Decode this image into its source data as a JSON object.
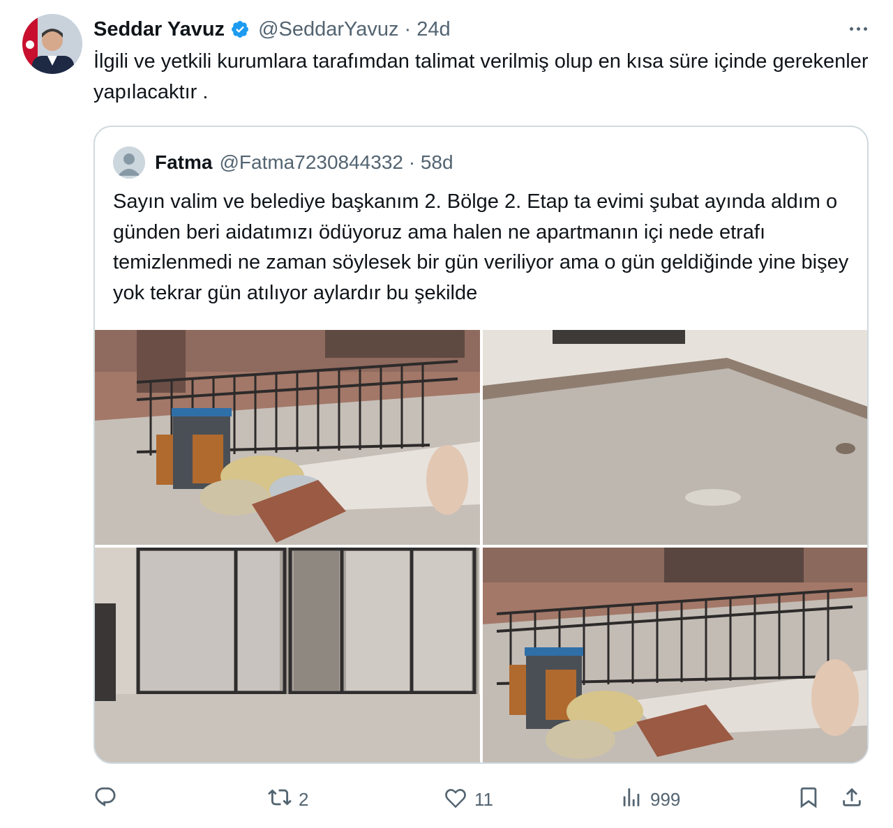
{
  "tweet": {
    "author_name": "Seddar Yavuz",
    "author_handle": "@SeddarYavuz",
    "separator": "·",
    "time": "24d",
    "text": "İlgili ve yetkili kurumlara tarafımdan talimat verilmiş olup en kısa süre içinde gerekenler yapılacaktır ."
  },
  "quoted": {
    "author_name": "Fatma",
    "author_handle": "@Fatma7230844332",
    "separator": "·",
    "time": "58d",
    "text": "Sayın valim ve belediye başkanım 2. Bölge 2. Etap ta evimi şubat ayında aldım o günden beri aidatımızı ödüyoruz ama halen ne apartmanın içi nede etrafı temizlenmedi ne zaman söylesek bir gün veriliyor ama o gün geldiğinde yine bişey yok tekrar gün atılıyor aylardır bu şekilde",
    "photos": [
      "photo-garbage-railing",
      "photo-empty-room",
      "photo-building-entrance",
      "photo-garbage-railing-2"
    ]
  },
  "actions": {
    "reply_count": "",
    "retweet_count": "2",
    "like_count": "11",
    "views_count": "999"
  },
  "icons": [
    "verified-badge-icon",
    "more-icon",
    "reply-icon",
    "retweet-icon",
    "like-icon",
    "views-icon",
    "bookmark-icon",
    "share-icon"
  ],
  "colors": {
    "verified": "#1d9bf0",
    "text": "#0f1419",
    "secondary": "#536471",
    "border": "#cfd9de"
  }
}
